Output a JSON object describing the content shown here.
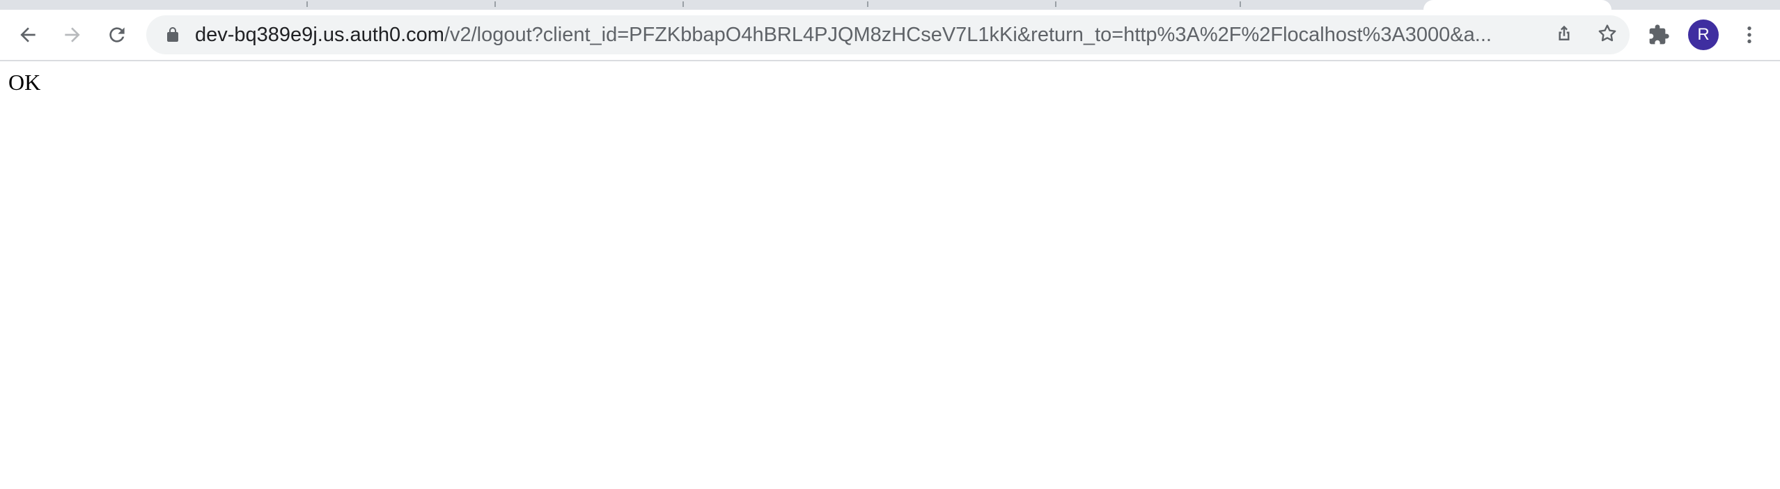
{
  "browser": {
    "address_bar": {
      "host": "dev-bq389e9j.us.auth0.com",
      "path": "/v2/logout?client_id=PFZKbbapO4hBRL4PJQM8zHCseV7L1kKi&return_to=http%3A%2F%2Flocalhost%3A3000&a..."
    },
    "profile_initial": "R",
    "profile_color": "#3f2ea0",
    "icons": {
      "back": "arrow-left-icon",
      "forward": "arrow-right-icon",
      "reload": "reload-icon",
      "lock": "lock-icon",
      "share": "share-icon",
      "bookmark": "star-icon",
      "extensions": "puzzle-icon",
      "menu": "kebab-menu-icon"
    }
  },
  "page": {
    "body_text": "OK"
  }
}
